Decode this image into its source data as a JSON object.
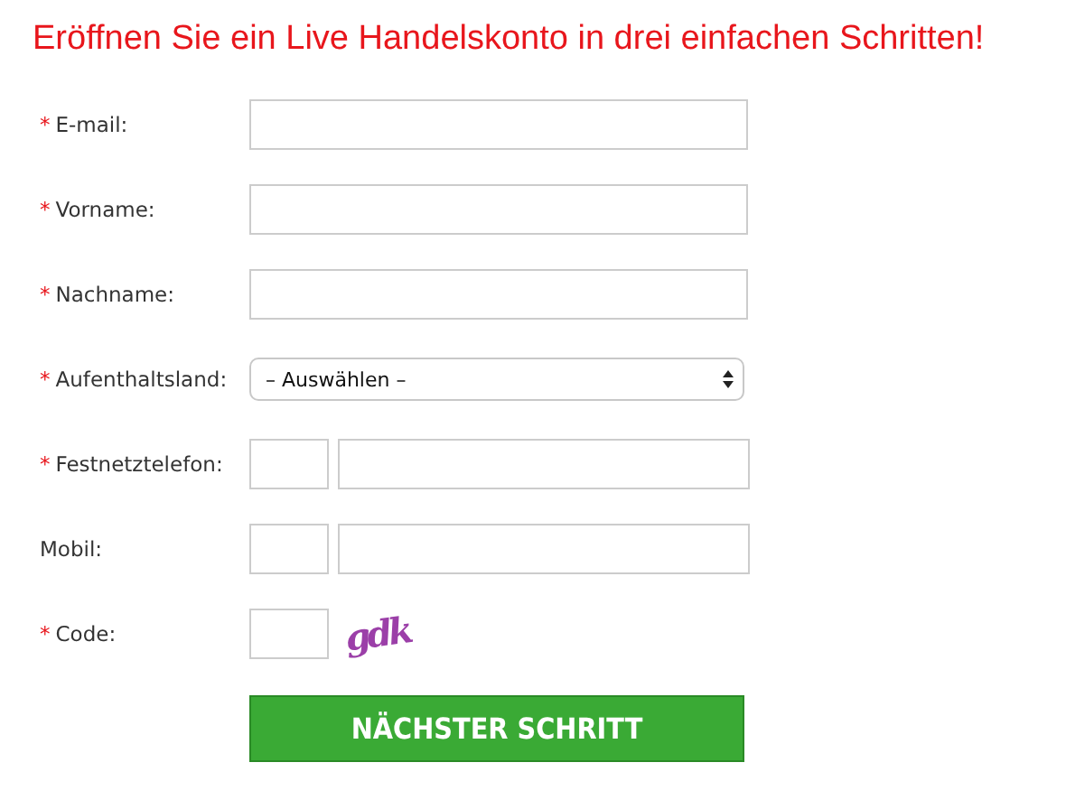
{
  "title": "Eröffnen Sie ein Live Handelskonto in drei einfachen Schritten!",
  "fields": [
    {
      "kind": "text",
      "mark": "*",
      "label": "E-mail:"
    },
    {
      "kind": "text",
      "mark": "*",
      "label": "Vorname:"
    },
    {
      "kind": "text",
      "mark": "*",
      "label": "Nachname:"
    },
    {
      "kind": "select",
      "mark": "*",
      "label": "Aufenthaltsland:",
      "value": "– Auswählen –"
    },
    {
      "kind": "phone",
      "mark": "*",
      "label": "Festnetztelefon:"
    },
    {
      "kind": "phone",
      "label": "Mobil:"
    },
    {
      "kind": "code",
      "mark": "*",
      "label": "Code:",
      "captcha": "gdk"
    }
  ],
  "button": "NÄCHSTER SCHRITT"
}
